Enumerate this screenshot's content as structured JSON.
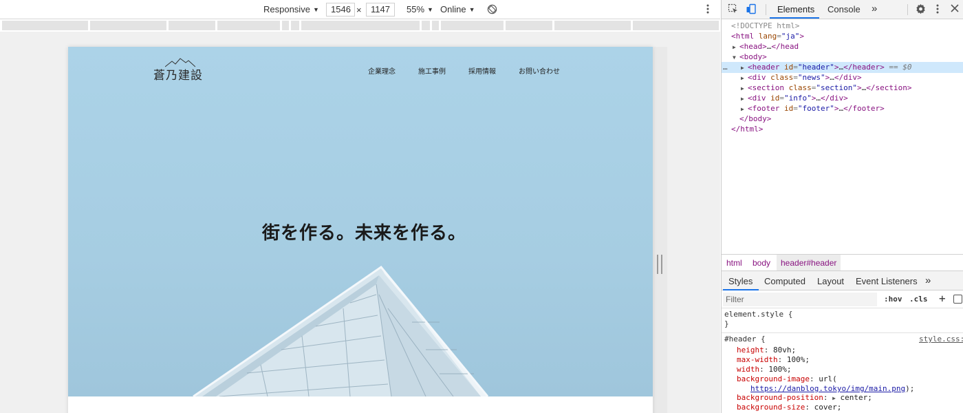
{
  "device_toolbar": {
    "mode": "Responsive",
    "width": "1546",
    "height": "1147",
    "times": "×",
    "zoom": "55%",
    "network": "Online"
  },
  "site": {
    "logo_text": "蒼乃建設",
    "nav": [
      "企業理念",
      "施工事例",
      "採用情報",
      "お問い合わせ"
    ],
    "hero_title": "街を作る。未来を作る。",
    "hero_bg_color": "#a8cfe4"
  },
  "devtools": {
    "tabs": [
      "Elements",
      "Console"
    ],
    "active_tab": "Elements",
    "more_tabs": "»",
    "dom": {
      "doctype": "<!DOCTYPE html>",
      "html_open": {
        "tag": "html",
        "attr": "lang",
        "value": "ja"
      },
      "head": "head",
      "body": "body",
      "children": [
        {
          "tag": "header",
          "attr": "id",
          "value": "header",
          "suffix": "== $0",
          "selected": true
        },
        {
          "tag": "div",
          "attr": "class",
          "value": "news"
        },
        {
          "tag": "section",
          "attr": "class",
          "value": "section"
        },
        {
          "tag": "div",
          "attr": "id",
          "value": "info"
        },
        {
          "tag": "footer",
          "attr": "id",
          "value": "footer"
        }
      ],
      "body_close": "</body>",
      "html_close": "</html>",
      "ellipsis": "…",
      "gutter_dots": "…"
    },
    "breadcrumbs": [
      "html",
      "body",
      "header#header"
    ],
    "styles_tabs": [
      "Styles",
      "Computed",
      "Layout",
      "Event Listeners"
    ],
    "active_styles_tab": "Styles",
    "filter_placeholder": "Filter",
    "filter_hov": ":hov",
    "filter_cls": ".cls",
    "element_style_selector": "element.style {",
    "close_brace": "}",
    "rule": {
      "selector": "#header {",
      "source": "style.css:",
      "declarations": [
        {
          "name": "height",
          "value": "80vh;"
        },
        {
          "name": "max-width",
          "value": "100%;"
        },
        {
          "name": "width",
          "value": "100%;"
        },
        {
          "name": "background-image",
          "value": "url("
        },
        {
          "name": "background-position",
          "value": "center;"
        },
        {
          "name": "background-size",
          "value": "cover;"
        }
      ],
      "bg_url": "https://danblog.tokyo/img/main.png",
      "bg_url_close": ");"
    }
  },
  "colors": {
    "selection": "#cfe8fc",
    "accent": "#1a73e8",
    "tag": "#881280",
    "attr_name": "#994500",
    "attr_value": "#1a1aa6"
  }
}
